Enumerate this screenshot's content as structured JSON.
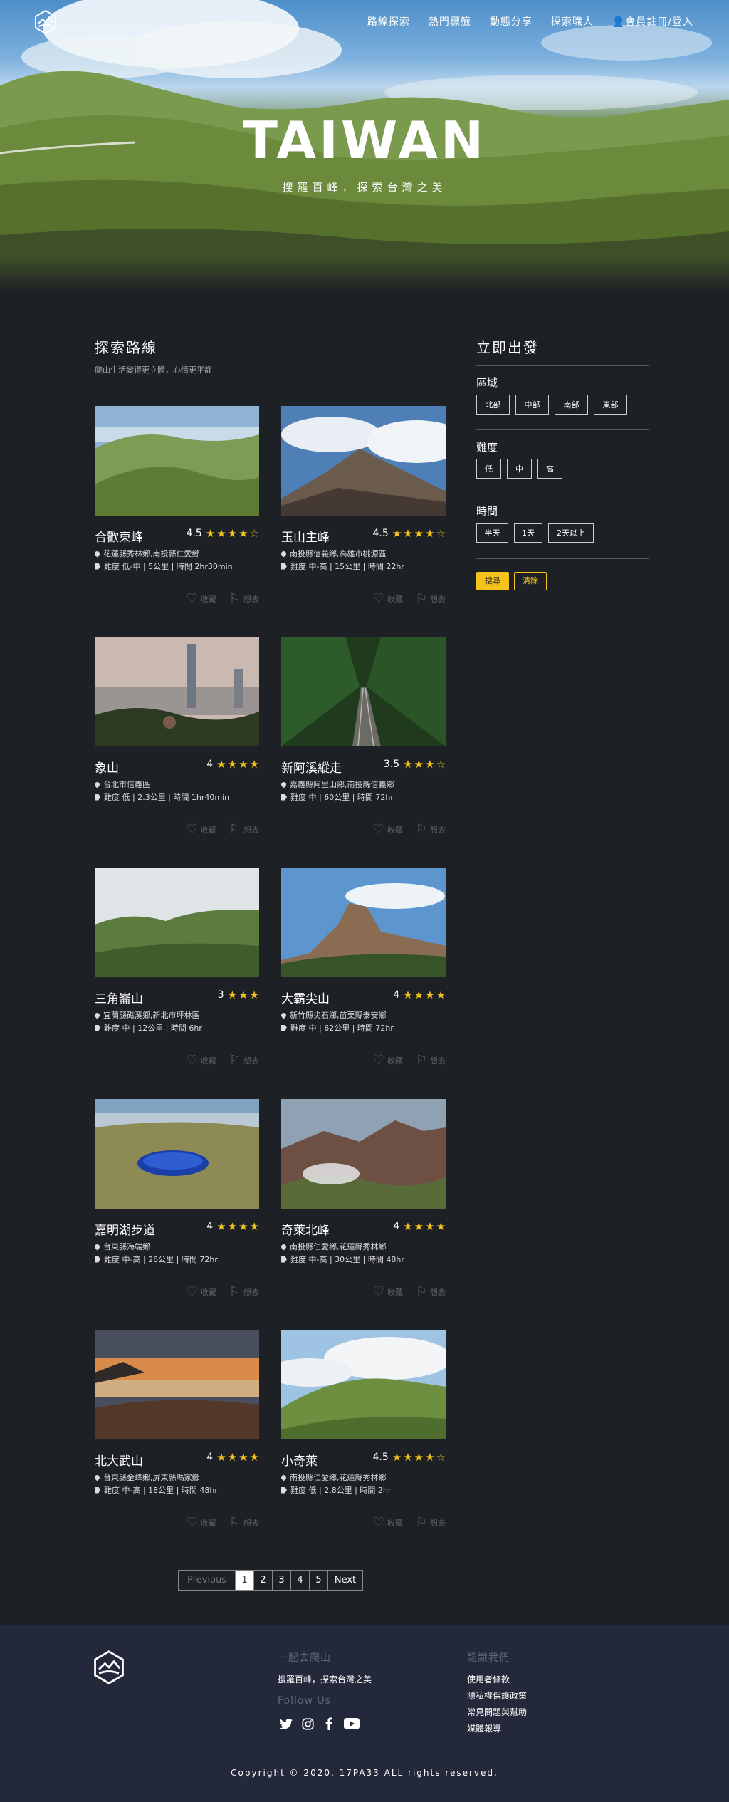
{
  "nav": {
    "items": [
      "路線探索",
      "熱門標籤",
      "動態分享",
      "探索職人"
    ],
    "member": "會員註冊/登入"
  },
  "hero": {
    "title": "TAIWAN",
    "subtitle": "搜羅百峰，探索台灣之美"
  },
  "section": {
    "title": "探索路線",
    "subtitle": "爬山生活變得更立體，心情更平靜"
  },
  "cards": [
    {
      "name": "合歡東峰",
      "rating": "4.5",
      "stars": [
        1,
        1,
        1,
        1,
        0
      ],
      "location": "花蓮縣秀林鄉,南投縣仁愛鄉",
      "meta": "難度  低-中  |  5公里  |  時間 2hr30min",
      "fav": "收藏",
      "go": "想去"
    },
    {
      "name": "玉山主峰",
      "rating": "4.5",
      "stars": [
        1,
        1,
        1,
        1,
        0
      ],
      "location": "南投縣信義鄉,高雄市桃源區",
      "meta": "難度  中-高  |  15公里  |  時間 22hr",
      "fav": "收藏",
      "go": "想去"
    },
    {
      "name": "象山",
      "rating": "4",
      "stars": [
        1,
        1,
        1,
        1
      ],
      "location": "台北市信義區",
      "meta": "難度  低  |  2.3公里  |  時間 1hr40min",
      "fav": "收藏",
      "go": "想去"
    },
    {
      "name": "新阿溪縱走",
      "rating": "3.5",
      "stars": [
        1,
        1,
        1,
        0
      ],
      "location": "嘉義縣阿里山鄉,南投縣信義鄉",
      "meta": "難度  中  |  60公里  |  時間 72hr",
      "fav": "收藏",
      "go": "想去"
    },
    {
      "name": "三角崙山",
      "rating": "3",
      "stars": [
        1,
        1,
        1
      ],
      "location": "宜蘭縣礁溪鄉,新北市坪林區",
      "meta": "難度  中  |  12公里  |  時間 6hr",
      "fav": "收藏",
      "go": "想去"
    },
    {
      "name": "大霸尖山",
      "rating": "4",
      "stars": [
        1,
        1,
        1,
        1
      ],
      "location": "新竹縣尖石鄉,苗栗縣泰安鄉",
      "meta": "難度  中  |  62公里  |  時間 72hr",
      "fav": "收藏",
      "go": "想去"
    },
    {
      "name": "嘉明湖步道",
      "rating": "4",
      "stars": [
        1,
        1,
        1,
        1
      ],
      "location": "台東縣海端鄉",
      "meta": "難度  中-高  |  26公里  |  時間 72hr",
      "fav": "收藏",
      "go": "想去"
    },
    {
      "name": "奇萊北峰",
      "rating": "4",
      "stars": [
        1,
        1,
        1,
        1
      ],
      "location": "南投縣仁愛鄉,花蓮縣秀林鄉",
      "meta": "難度  中-高  |  30公里  |  時間 48hr",
      "fav": "收藏",
      "go": "想去"
    },
    {
      "name": "北大武山",
      "rating": "4",
      "stars": [
        1,
        1,
        1,
        1
      ],
      "location": "台東縣金峰鄉,屏東縣瑪家鄉",
      "meta": "難度  中-高  |  18公里  |  時間 48hr",
      "fav": "收藏",
      "go": "想去"
    },
    {
      "name": "小奇萊",
      "rating": "4.5",
      "stars": [
        1,
        1,
        1,
        1,
        0
      ],
      "location": "南投縣仁愛鄉,花蓮縣秀林鄉",
      "meta": "難度  低  |  2.8公里  |  時間 2hr",
      "fav": "收藏",
      "go": "想去"
    }
  ],
  "sidebar": {
    "title": "立即出發",
    "region_label": "區域",
    "regions": [
      "北部",
      "中部",
      "南部",
      "東部"
    ],
    "difficulty_label": "難度",
    "difficulties": [
      "低",
      "中",
      "高"
    ],
    "time_label": "時間",
    "times": [
      "半天",
      "1天",
      "2天以上"
    ],
    "search": "搜尋",
    "clear": "清除"
  },
  "pagination": {
    "prev": "Previous",
    "pages": [
      "1",
      "2",
      "3",
      "4",
      "5"
    ],
    "active": "1",
    "next": "Next"
  },
  "footer": {
    "col1_title": "一起去爬山",
    "col1_text": "搜羅百峰，探索台灣之美",
    "follow": "Follow Us",
    "col2_title": "認識我們",
    "links": [
      "使用者條款",
      "隱私權保護政策",
      "常見問題與幫助",
      "媒體報導"
    ],
    "copyright": "Copyright © 2020, 17PA33 ALL rights reserved."
  },
  "colors": {
    "accent": "#f4c21b",
    "background": "#1d2024",
    "footer": "#23283a"
  }
}
